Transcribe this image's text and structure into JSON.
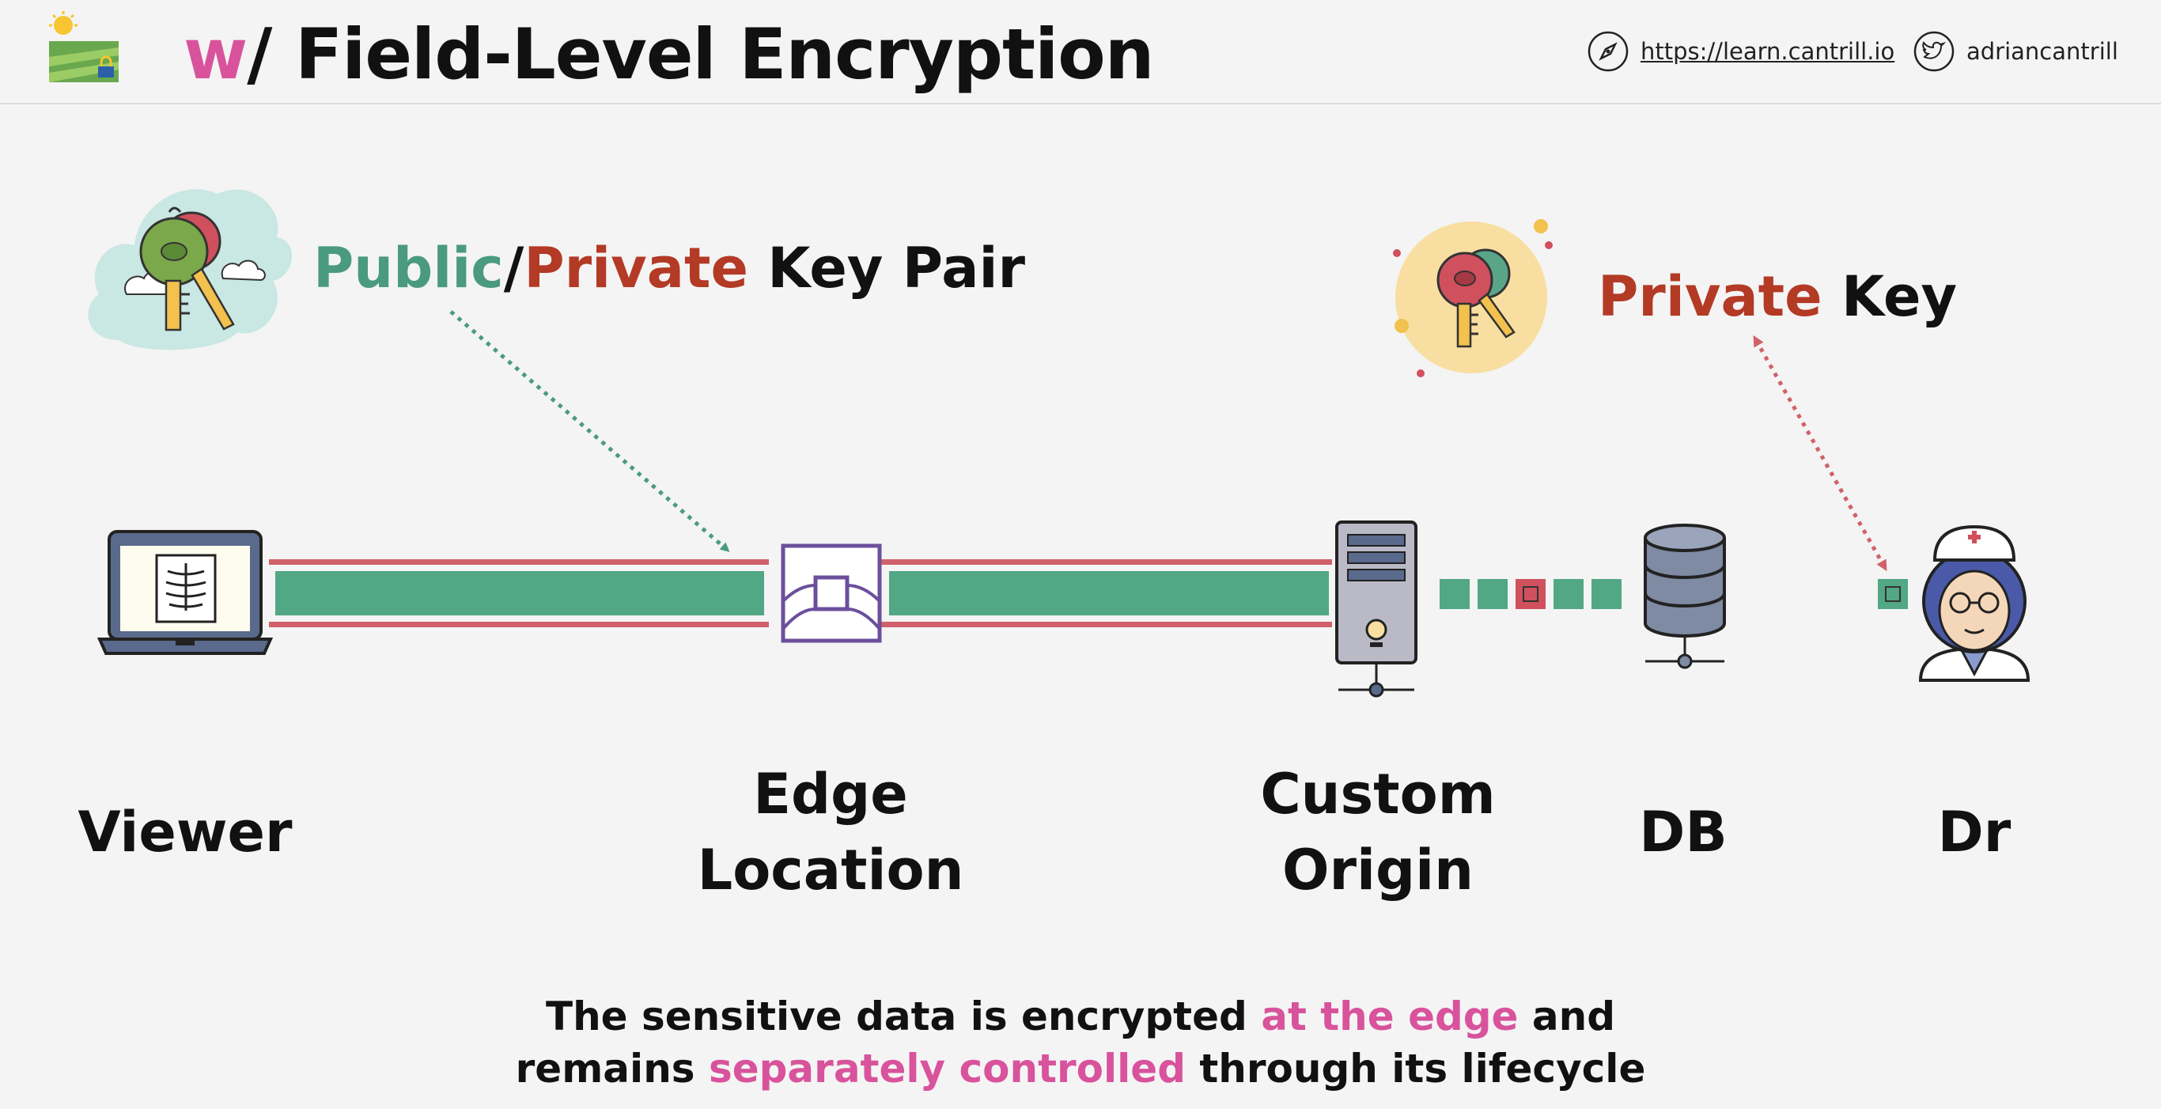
{
  "header": {
    "title_prefix": "w",
    "title_rest": "/ Field-Level Encryption",
    "site_link": "https://learn.cantrill.io",
    "twitter_handle": "adriancantrill",
    "icons": [
      "compass-icon",
      "twitter-icon"
    ]
  },
  "keypair": {
    "public_label": "Public",
    "slash": "/",
    "private_label": "Private",
    "rest_label": " Key Pair"
  },
  "private_key": {
    "private_label": "Private",
    "rest_label": " Key"
  },
  "nodes": {
    "viewer": "Viewer",
    "edge_line1": "Edge",
    "edge_line2": "Location",
    "origin_line1": "Custom",
    "origin_line2": "Origin",
    "db": "DB",
    "dr": "Dr"
  },
  "caption": {
    "line1_a": "The sensitive data is encrypted ",
    "line1_b": "at the edge",
    "line1_c": " and",
    "line2_a": "remains ",
    "line2_b": "separately controlled",
    "line2_c": " through its lifecycle"
  },
  "colors": {
    "accent_pink": "#d8539c",
    "public_green": "#4a9a80",
    "private_red": "#b33a25",
    "tunnel_green": "#52a785",
    "tunnel_border": "#d0616a",
    "edge_purple": "#6b4f9c"
  }
}
